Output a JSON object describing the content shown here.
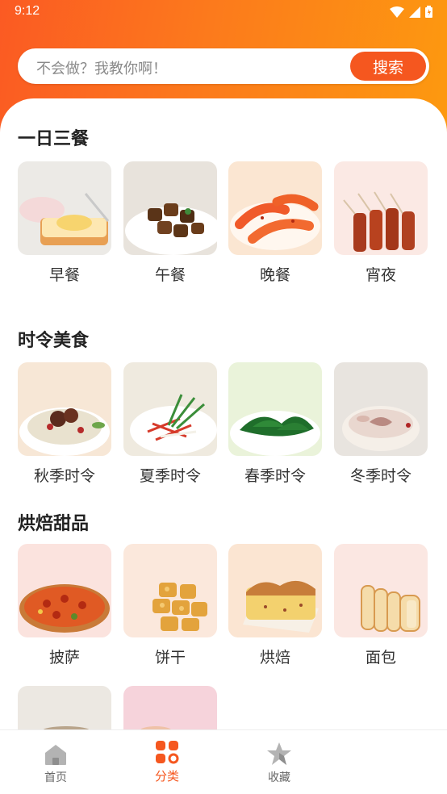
{
  "status": {
    "time": "9:12"
  },
  "search": {
    "placeholder": "不会做？我教你啊！",
    "button_label": "搜索"
  },
  "sections": [
    {
      "title": "一日三餐",
      "items": [
        "早餐",
        "午餐",
        "晚餐",
        "宵夜"
      ]
    },
    {
      "title": "时令美食",
      "items": [
        "秋季时令",
        "夏季时令",
        "春季时令",
        "冬季时令"
      ]
    },
    {
      "title": "烘焙甜品",
      "items": [
        "披萨",
        "饼干",
        "烘焙",
        "面包"
      ]
    }
  ],
  "nav": {
    "items": [
      "首页",
      "分类",
      "收藏"
    ],
    "active": "分类"
  },
  "colors": {
    "accent": "#f5571f",
    "header_start": "#fb5a23",
    "header_end": "#fd9a0f"
  }
}
